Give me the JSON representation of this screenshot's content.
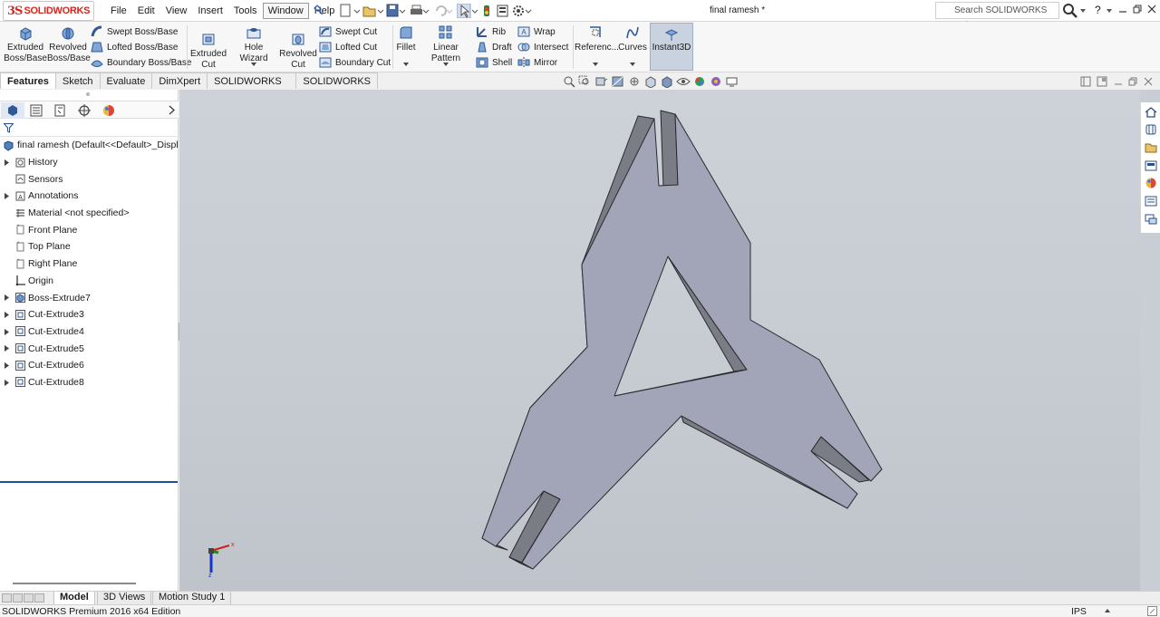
{
  "app": {
    "logo_text": "SOLIDWORKS",
    "document_title": "final ramesh *",
    "menu": [
      "File",
      "Edit",
      "View",
      "Insert",
      "Tools",
      "Window",
      "Help"
    ],
    "active_menu": "Window",
    "help_search_placeholder": "Search SOLIDWORKS Help",
    "help_symbol": "?"
  },
  "ribbon": {
    "extruded_boss": "Extruded Boss/Base",
    "revolved_boss": "Revolved Boss/Base",
    "swept_boss": "Swept Boss/Base",
    "lofted_boss": "Lofted Boss/Base",
    "boundary_boss": "Boundary Boss/Base",
    "extruded_cut": "Extruded Cut",
    "hole_wizard": "Hole Wizard",
    "revolved_cut": "Revolved Cut",
    "swept_cut": "Swept Cut",
    "lofted_cut": "Lofted Cut",
    "boundary_cut": "Boundary Cut",
    "fillet": "Fillet",
    "linear_pattern": "Linear Pattern",
    "rib": "Rib",
    "draft": "Draft",
    "shell": "Shell",
    "wrap": "Wrap",
    "intersect": "Intersect",
    "mirror": "Mirror",
    "reference": "Referenc...",
    "curves": "Curves",
    "instant3d": "Instant3D"
  },
  "cm_tabs": [
    "Features",
    "Sketch",
    "Evaluate",
    "DimXpert",
    "SOLIDWORKS Add-Ins",
    "SOLIDWORKS MBD"
  ],
  "feature_tree": {
    "root": "final ramesh  (Default<<Default>_Displa",
    "items": [
      {
        "label": "History",
        "expandable": true,
        "icon": "history-icon"
      },
      {
        "label": "Sensors",
        "expandable": false,
        "icon": "sensors-icon"
      },
      {
        "label": "Annotations",
        "expandable": true,
        "icon": "annotations-icon"
      },
      {
        "label": "Material <not specified>",
        "expandable": false,
        "icon": "material-icon"
      },
      {
        "label": "Front Plane",
        "expandable": false,
        "icon": "plane-icon"
      },
      {
        "label": "Top Plane",
        "expandable": false,
        "icon": "plane-icon"
      },
      {
        "label": "Right Plane",
        "expandable": false,
        "icon": "plane-icon"
      },
      {
        "label": "Origin",
        "expandable": false,
        "icon": "origin-icon"
      },
      {
        "label": "Boss-Extrude7",
        "expandable": true,
        "icon": "boss-extrude-icon"
      },
      {
        "label": "Cut-Extrude3",
        "expandable": true,
        "icon": "cut-extrude-icon"
      },
      {
        "label": "Cut-Extrude4",
        "expandable": true,
        "icon": "cut-extrude-icon"
      },
      {
        "label": "Cut-Extrude5",
        "expandable": true,
        "icon": "cut-extrude-icon"
      },
      {
        "label": "Cut-Extrude6",
        "expandable": true,
        "icon": "cut-extrude-icon"
      },
      {
        "label": "Cut-Extrude8",
        "expandable": true,
        "icon": "cut-extrude-icon"
      }
    ]
  },
  "bottom_tabs": [
    "Model",
    "3D Views",
    "Motion Study 1"
  ],
  "status": {
    "edition": "SOLIDWORKS Premium 2016 x64 Edition",
    "units": "IPS"
  },
  "colors": {
    "part_face": "#a2a5b7",
    "part_side": "#7a7c86",
    "logo_red": "#d9261c",
    "highlight_blue": "#1f4e9a"
  }
}
